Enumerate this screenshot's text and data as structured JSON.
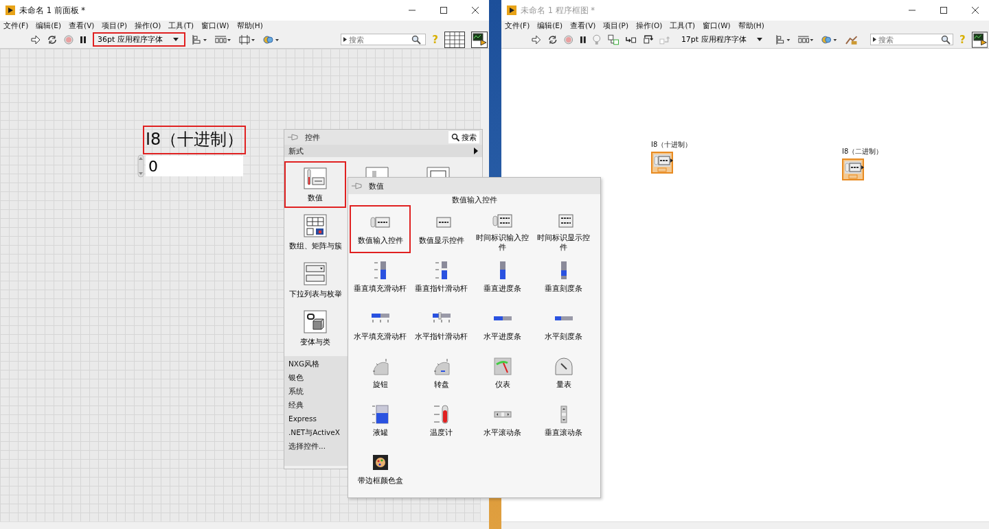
{
  "windows": [
    {
      "kind": "front_panel",
      "title": "未命名 1 前面板 *",
      "active": true,
      "menu": [
        "文件(F)",
        "编辑(E)",
        "查看(V)",
        "项目(P)",
        "操作(O)",
        "工具(T)",
        "窗口(W)",
        "帮助(H)"
      ],
      "font_menu": {
        "value": "36pt 应用程序字体",
        "highlighted": true
      },
      "search": {
        "placeholder": "搜索"
      },
      "help_button": "?",
      "controls": [
        {
          "label": "I8（十进制）",
          "value": "0",
          "highlighted": true
        }
      ]
    },
    {
      "kind": "block_diagram",
      "title": "未命名 1 程序框图 *",
      "active": false,
      "menu": [
        "文件(F)",
        "编辑(E)",
        "查看(V)",
        "项目(P)",
        "操作(O)",
        "工具(T)",
        "窗口(W)",
        "帮助(H)"
      ],
      "font_menu": {
        "value": "17pt 应用程序字体",
        "highlighted": false
      },
      "search": {
        "placeholder": "搜索"
      },
      "help_button": "?",
      "terminals": [
        {
          "label": "I8（十进制）"
        },
        {
          "label": "I8（二进制）"
        }
      ]
    }
  ],
  "controls_palette": {
    "title": "控件",
    "search_button": "搜索",
    "category": "新式",
    "items": [
      {
        "label": "数值",
        "kind": "numeric",
        "highlighted": true
      },
      {
        "label": "数组、矩阵与簇",
        "kind": "array",
        "highlighted": false
      },
      {
        "label": "下拉列表与枚举",
        "kind": "ring",
        "highlighted": false
      },
      {
        "label": "变体与类",
        "kind": "variant",
        "highlighted": false
      }
    ],
    "sections": [
      "NXG风格",
      "银色",
      "系统",
      "经典",
      "Express",
      ".NET与ActiveX",
      "选择控件..."
    ]
  },
  "numeric_palette": {
    "title": "数值",
    "heading": "数值输入控件",
    "items": [
      {
        "label": "数值输入控件",
        "kind": "numeric_control",
        "highlighted": true
      },
      {
        "label": "数值显示控件",
        "kind": "numeric_indicator",
        "highlighted": false
      },
      {
        "label": "时间标识输入控件",
        "kind": "time_control",
        "highlighted": false
      },
      {
        "label": "时间标识显示控件",
        "kind": "time_indicator",
        "highlighted": false
      },
      {
        "label": "垂直填充滑动杆",
        "kind": "vfill",
        "highlighted": false
      },
      {
        "label": "垂直指针滑动杆",
        "kind": "vpointer",
        "highlighted": false
      },
      {
        "label": "垂直进度条",
        "kind": "vprogress",
        "highlighted": false
      },
      {
        "label": "垂直刻度条",
        "kind": "vgraduated",
        "highlighted": false
      },
      {
        "label": "水平填充滑动杆",
        "kind": "hfill",
        "highlighted": false
      },
      {
        "label": "水平指针滑动杆",
        "kind": "hpointer",
        "highlighted": false
      },
      {
        "label": "水平进度条",
        "kind": "hprogress",
        "highlighted": false
      },
      {
        "label": "水平刻度条",
        "kind": "hgraduated",
        "highlighted": false
      },
      {
        "label": "旋钮",
        "kind": "knob",
        "highlighted": false
      },
      {
        "label": "转盘",
        "kind": "dial",
        "highlighted": false
      },
      {
        "label": "仪表",
        "kind": "meter",
        "highlighted": false
      },
      {
        "label": "量表",
        "kind": "gauge",
        "highlighted": false
      },
      {
        "label": "液罐",
        "kind": "tank",
        "highlighted": false
      },
      {
        "label": "温度计",
        "kind": "thermometer",
        "highlighted": false
      },
      {
        "label": "水平滚动条",
        "kind": "hscroll",
        "highlighted": false
      },
      {
        "label": "垂直滚动条",
        "kind": "vscroll",
        "highlighted": false
      },
      {
        "label": "带边框颜色盒",
        "kind": "colorbox",
        "highlighted": false
      }
    ]
  }
}
